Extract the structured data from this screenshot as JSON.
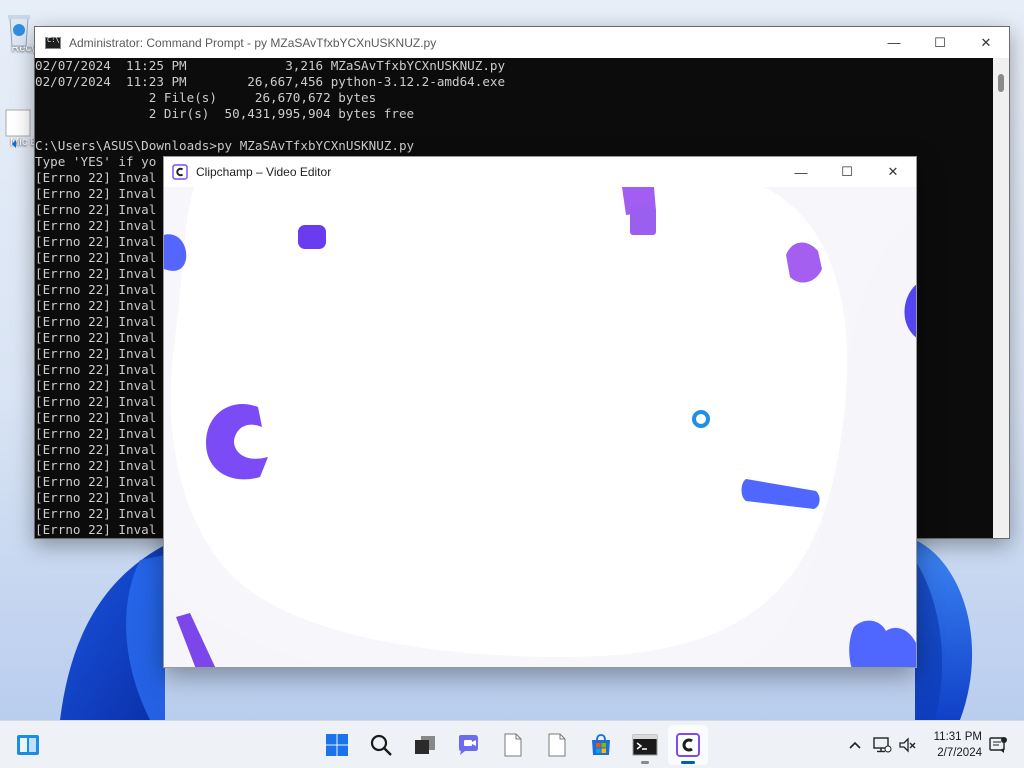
{
  "desktop": {
    "icons": [
      {
        "label": "Recy",
        "icon": "recycle-bin-icon"
      },
      {
        "label": "Mic E",
        "icon": "edge-shortcut-icon"
      }
    ]
  },
  "cmd": {
    "title": "Administrator: Command Prompt - py  MZaSAvTfxbYCXnUSKNUZ.py",
    "lines": [
      "02/07/2024  11:25 PM             3,216 MZaSAvTfxbYCXnUSKNUZ.py",
      "02/07/2024  11:23 PM        26,667,456 python-3.12.2-amd64.exe",
      "               2 File(s)     26,670,672 bytes",
      "               2 Dir(s)  50,431,995,904 bytes free",
      "",
      "C:\\Users\\ASUS\\Downloads>py MZaSAvTfxbYCXnUSKNUZ.py",
      "Type 'YES' if yo",
      "[Errno 22] Inval",
      "[Errno 22] Inval",
      "[Errno 22] Inval",
      "[Errno 22] Inval",
      "[Errno 22] Inval",
      "[Errno 22] Inval",
      "[Errno 22] Inval",
      "[Errno 22] Inval",
      "[Errno 22] Inval",
      "[Errno 22] Inval",
      "[Errno 22] Inval",
      "[Errno 22] Inval",
      "[Errno 22] Inval",
      "[Errno 22] Inval",
      "[Errno 22] Inval",
      "[Errno 22] Inval",
      "[Errno 22] Inval",
      "[Errno 22] Inval",
      "[Errno 22] Inval",
      "[Errno 22] Inval",
      "[Errno 22] Inval",
      "[Errno 22] Inval",
      "[Errno 22] Inval",
      "[Errno 22] Inval"
    ],
    "buttons": {
      "minimize": "—",
      "maximize": "☐",
      "close": "✕"
    }
  },
  "clipchamp": {
    "title": "Clipchamp – Video Editor",
    "buttons": {
      "minimize": "—",
      "maximize": "☐",
      "close": "✕"
    },
    "loading": true,
    "colors": {
      "accent": "#7b4cf5",
      "blue": "#4f5fff",
      "violet": "#9b5ff0",
      "spinner": "#1e90e8"
    }
  },
  "taskbar": {
    "apps": [
      {
        "name": "start-button",
        "icon": "windows-logo-icon"
      },
      {
        "name": "search-button",
        "icon": "search-icon"
      },
      {
        "name": "task-view-button",
        "icon": "task-view-icon"
      },
      {
        "name": "chat-button",
        "icon": "chat-icon"
      },
      {
        "name": "file-button-1",
        "icon": "file-icon"
      },
      {
        "name": "file-button-2",
        "icon": "file-icon"
      },
      {
        "name": "store-button",
        "icon": "store-icon"
      },
      {
        "name": "terminal-button",
        "icon": "terminal-icon"
      },
      {
        "name": "clipchamp-button",
        "icon": "clipchamp-icon"
      }
    ],
    "time": "11:31 PM",
    "date": "2/7/2024"
  }
}
